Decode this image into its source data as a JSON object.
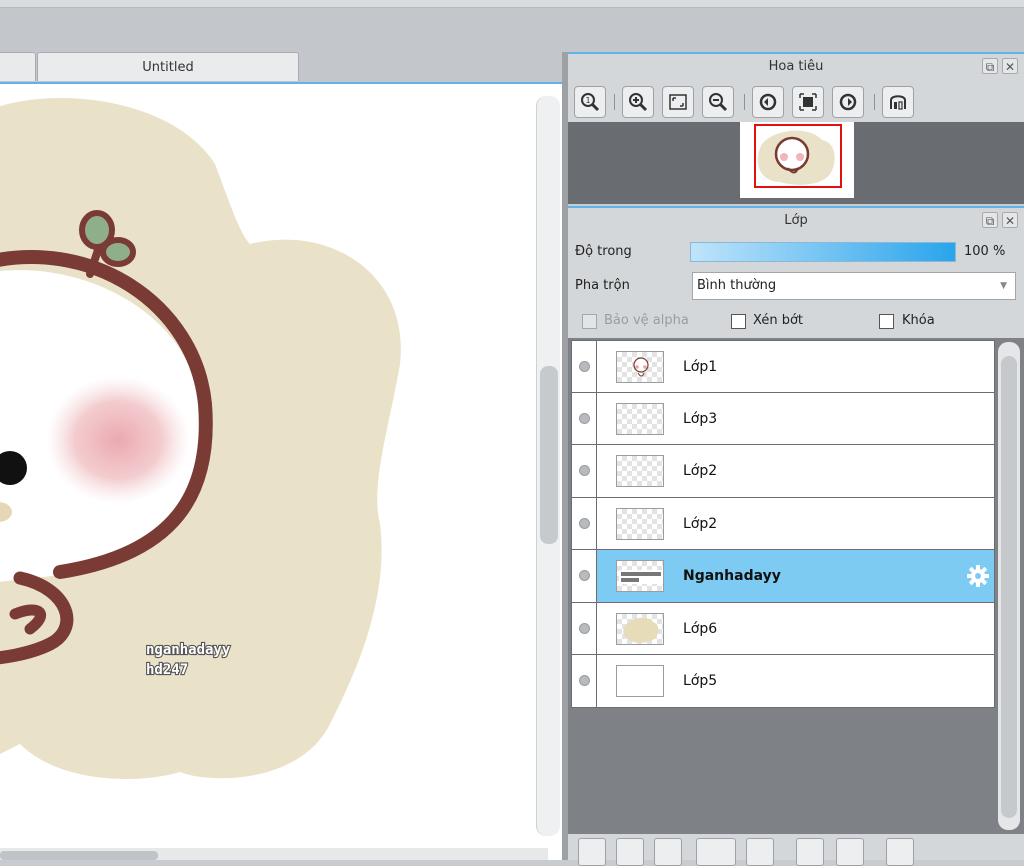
{
  "document": {
    "tab_title": "Untitled",
    "watermark_line1": "nganhadayy",
    "watermark_line2": "hd247"
  },
  "navigator": {
    "title": "Hoa tiêu",
    "tools": [
      "zoom-reset-icon",
      "zoom-in-icon",
      "fit-screen-icon",
      "zoom-out-icon",
      "rotate-left-icon",
      "actual-size-icon",
      "rotate-right-icon",
      "flip-horizontal-icon"
    ]
  },
  "layers_panel": {
    "title": "Lớp",
    "opacity_label": "Độ trong",
    "opacity_value": "100 %",
    "opacity_fraction": 1.0,
    "blend_label": "Pha trộn",
    "blend_value": "Bình thường",
    "protect_alpha_label": "Bảo vệ alpha",
    "clipping_label": "Xén bớt",
    "lock_label": "Khóa",
    "layers": [
      {
        "name": "Lớp1",
        "selected": false
      },
      {
        "name": "Lớp3",
        "selected": false
      },
      {
        "name": "Lớp2",
        "selected": false
      },
      {
        "name": "Lớp2",
        "selected": false
      },
      {
        "name": "Nganhadayy",
        "selected": true
      },
      {
        "name": "Lớp6",
        "selected": false
      },
      {
        "name": "Lớp5",
        "selected": false
      }
    ]
  },
  "colors": {
    "accent": "#5fb3e6",
    "selected_row": "#7dcbf2",
    "cloud": "#e9e2c9",
    "outline": "#7a3b34",
    "blush": "#e9a4ab",
    "sprout": "#8fae8a"
  }
}
